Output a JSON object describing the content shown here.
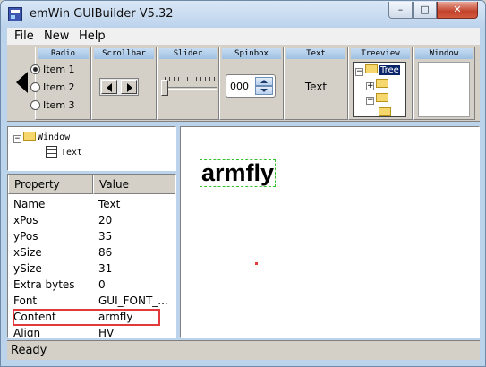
{
  "app": {
    "title": "emWin GUIBuilder V5.32",
    "caption_buttons": {
      "minimize": "–",
      "maximize": "□",
      "close": "✕"
    }
  },
  "menu": {
    "items": [
      "File",
      "New",
      "Help"
    ]
  },
  "toolbar": {
    "radio": {
      "title": "Radio",
      "items": [
        "Item 1",
        "Item 2",
        "Item 3"
      ],
      "selected_index": 0
    },
    "scrollbar": {
      "title": "Scrollbar"
    },
    "slider": {
      "title": "Slider"
    },
    "spinbox": {
      "title": "Spinbox",
      "value": "000"
    },
    "text": {
      "title": "Text",
      "sample": "Text"
    },
    "treeview": {
      "title": "Treeview",
      "sample_root": "Tree"
    },
    "window": {
      "title": "Window"
    }
  },
  "object_tree": {
    "root": "Window",
    "child": "Text"
  },
  "properties": {
    "headers": {
      "property": "Property",
      "value": "Value"
    },
    "rows": [
      {
        "name": "Name",
        "value": "Text"
      },
      {
        "name": "xPos",
        "value": "20"
      },
      {
        "name": "yPos",
        "value": "35"
      },
      {
        "name": "xSize",
        "value": "86"
      },
      {
        "name": "ySize",
        "value": "31"
      },
      {
        "name": "Extra bytes",
        "value": "0"
      },
      {
        "name": "Font",
        "value": "GUI_FONT_..."
      },
      {
        "name": "Content",
        "value": "armfly"
      },
      {
        "name": "Align",
        "value": "HV"
      }
    ],
    "highlight_color": "#e23a3a"
  },
  "canvas": {
    "text": "armfly",
    "selection_color": "#35c22f"
  },
  "status": {
    "text": "Ready"
  }
}
